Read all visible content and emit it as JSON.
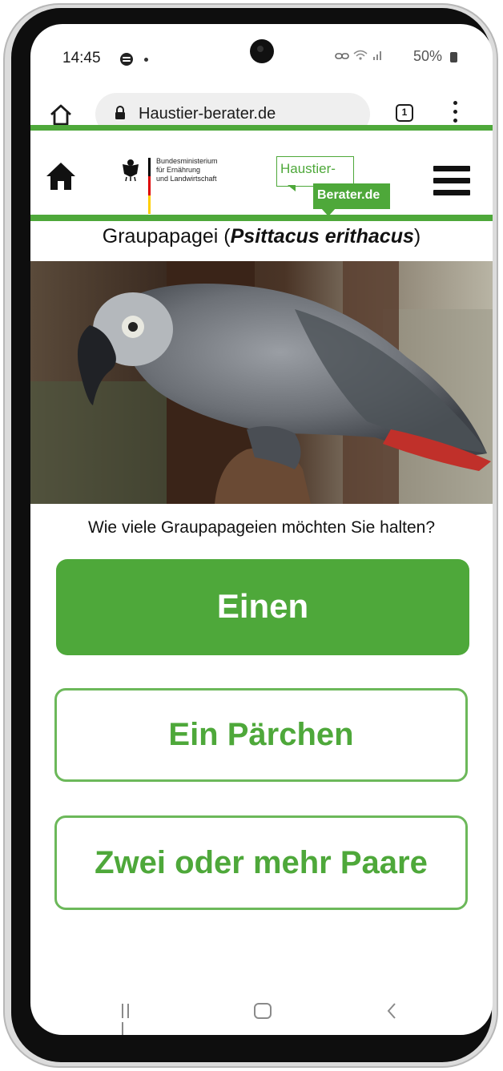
{
  "status_bar": {
    "time": "14:45",
    "battery": "50%"
  },
  "browser": {
    "url": "Haustier-berater.de",
    "tab_count": "1"
  },
  "site_header": {
    "ministry_line1": "Bundesministerium",
    "ministry_line2": "für Ernährung",
    "ministry_line3": "und Landwirtschaft",
    "logo_top": "Haustier-",
    "logo_bottom": "Berater.de"
  },
  "page": {
    "title_common": "Graupapagei (",
    "title_latin": "Psittacus erithacus",
    "title_close": ")",
    "question": "Wie viele Graupapageien möchten Sie halten?",
    "choices": [
      "Einen",
      "Ein Pärchen",
      "Zwei oder mehr Paare"
    ]
  },
  "colors": {
    "brand_green": "#4ea83a",
    "button_border": "#6cb85a"
  },
  "icons": {
    "browser_home": "home-outline-icon",
    "site_home": "home-filled-icon",
    "lock": "lock-icon",
    "menu": "hamburger-icon",
    "overflow": "vertical-dots-icon",
    "nav_recent": "recent-apps-icon",
    "nav_home": "nav-home-icon",
    "nav_back": "back-chevron-icon"
  }
}
